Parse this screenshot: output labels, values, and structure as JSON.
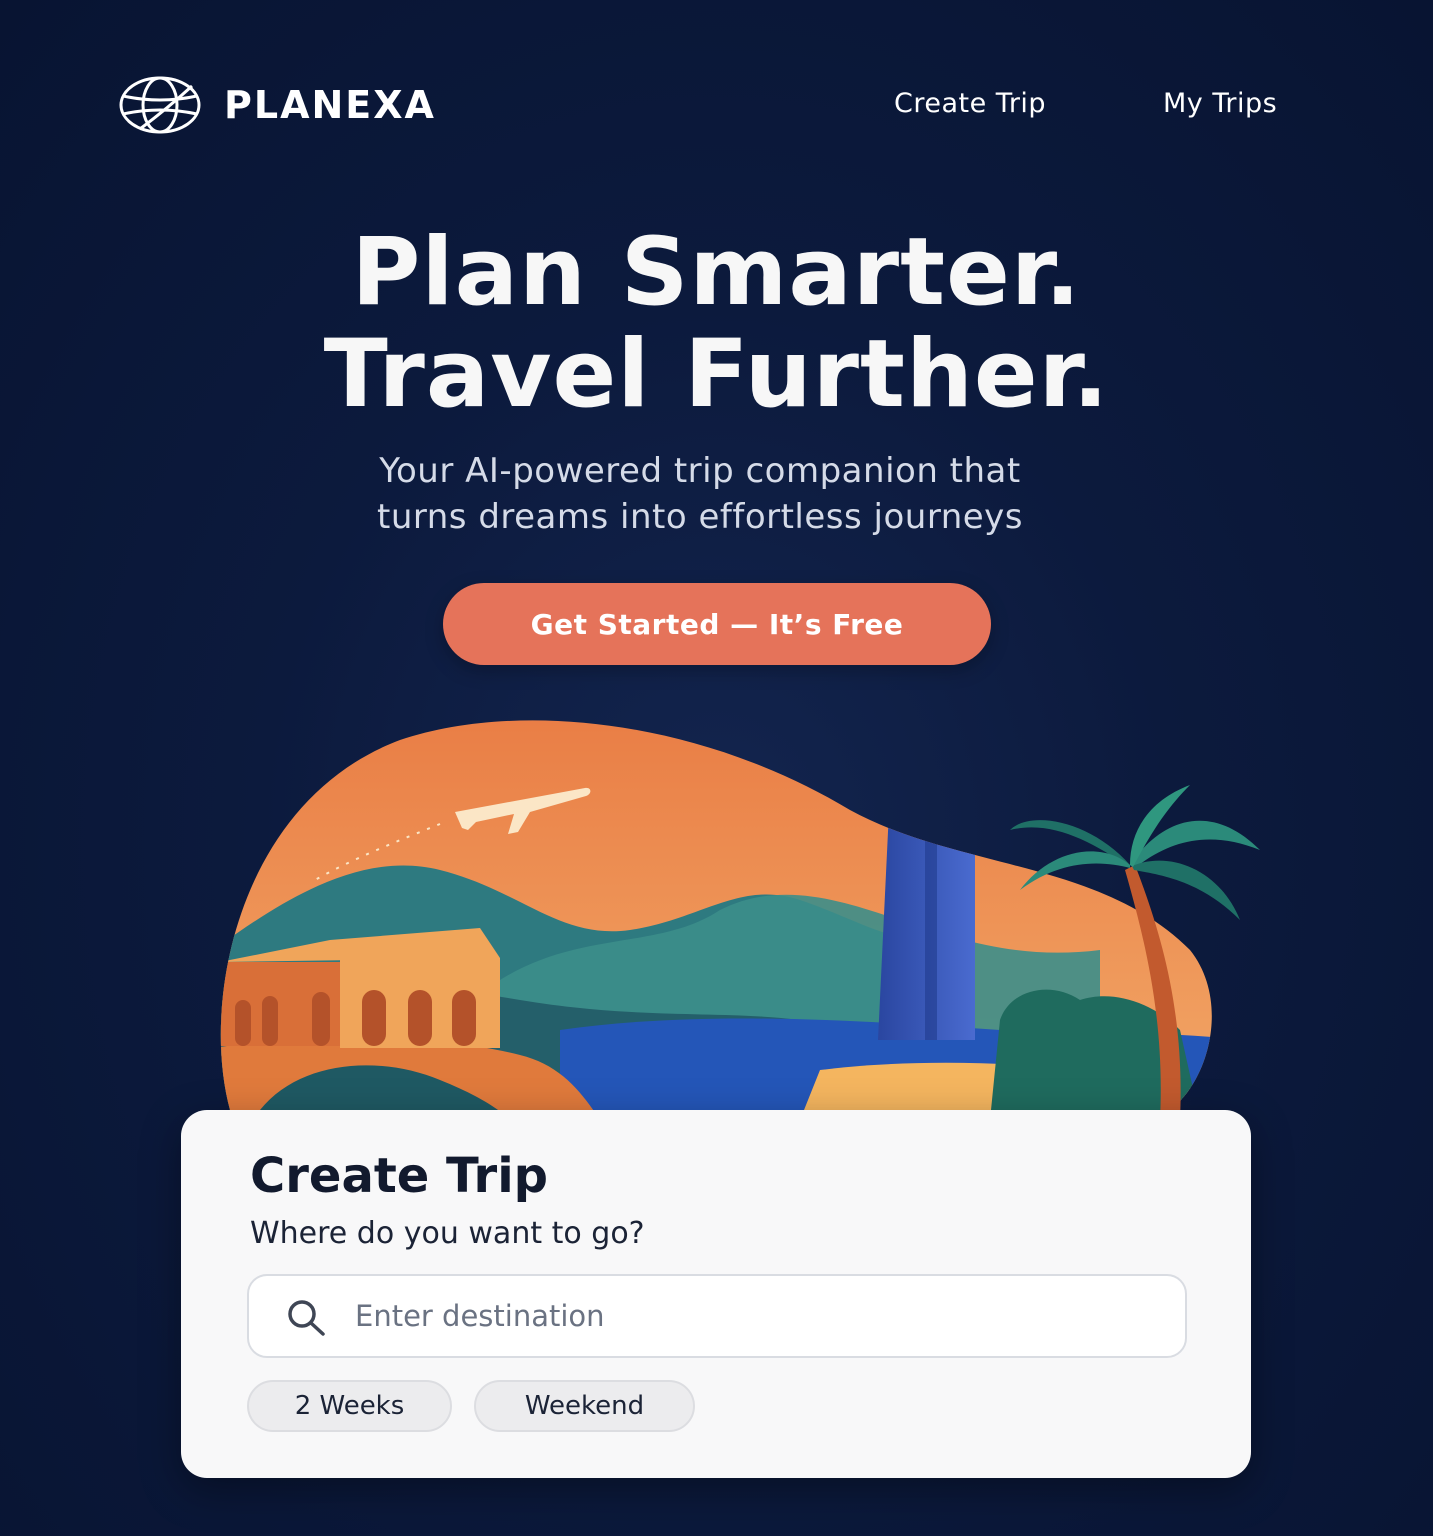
{
  "brand": {
    "name": "PLANEXA",
    "logo_icon": "globe-icon"
  },
  "nav": {
    "items": [
      {
        "label": "Create Trip"
      },
      {
        "label": "My Trips"
      }
    ]
  },
  "hero": {
    "title_line1": "Plan Smarter.",
    "title_line2": "Travel Further.",
    "subtitle_line1": "Your AI-powered trip companion that",
    "subtitle_line2": "turns dreams into effortless journeys",
    "cta_label": "Get Started — It’s Free"
  },
  "illustration": {
    "elements": [
      "airplane-icon",
      "mountains",
      "temple",
      "tower",
      "palm-tree",
      "water",
      "beach"
    ]
  },
  "create_trip": {
    "title": "Create Trip",
    "question": "Where do you want to go?",
    "search_placeholder": "Enter destination",
    "search_value": "",
    "search_icon": "search-icon",
    "durations": [
      {
        "label": "2 Weeks"
      },
      {
        "label": "Weekend"
      }
    ]
  },
  "colors": {
    "background": "#0c1a3d",
    "accent": "#e5735a",
    "card": "#f8f8f9",
    "text_dark": "#121a2e"
  }
}
